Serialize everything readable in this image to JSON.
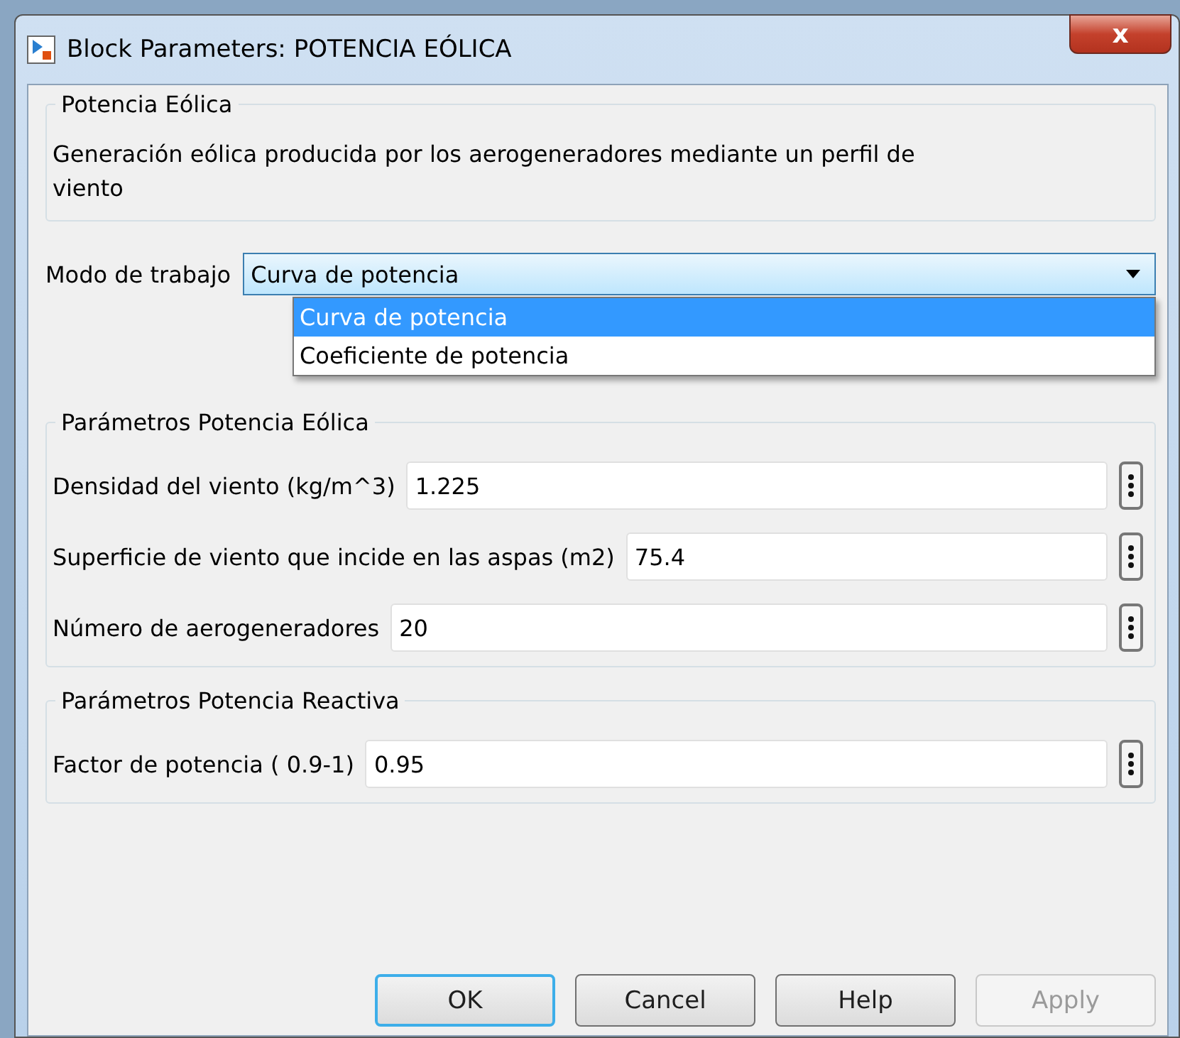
{
  "window": {
    "title": "Block Parameters: POTENCIA EÓLICA",
    "close": "x"
  },
  "description_group": {
    "title": "Potencia Eólica",
    "text": "Generación eólica producida por los aerogeneradores mediante un perfil de viento"
  },
  "mode": {
    "label": "Modo de trabajo",
    "value": "Curva de potencia",
    "expanded": true,
    "options": [
      {
        "label": "Curva de potencia",
        "selected": true
      },
      {
        "label": "Coeficiente de potencia",
        "selected": false
      }
    ]
  },
  "groups": [
    {
      "title": "Parámetros Potencia Eólica",
      "params": [
        {
          "label": "Densidad del viento (kg/m^3)",
          "value": "1.225"
        },
        {
          "label": "Superficie de viento que incide en las aspas (m2)",
          "value": "75.4"
        },
        {
          "label": "Número de aerogeneradores",
          "value": "20"
        }
      ]
    },
    {
      "title": "Parámetros Potencia Reactiva",
      "params": [
        {
          "label": "Factor de potencia ( 0.9-1)",
          "value": "0.95"
        }
      ]
    }
  ],
  "buttons": [
    {
      "label": "OK",
      "default": true,
      "disabled": false
    },
    {
      "label": "Cancel",
      "default": false,
      "disabled": false
    },
    {
      "label": "Help",
      "default": false,
      "disabled": false
    },
    {
      "label": "Apply",
      "default": false,
      "disabled": true
    }
  ]
}
